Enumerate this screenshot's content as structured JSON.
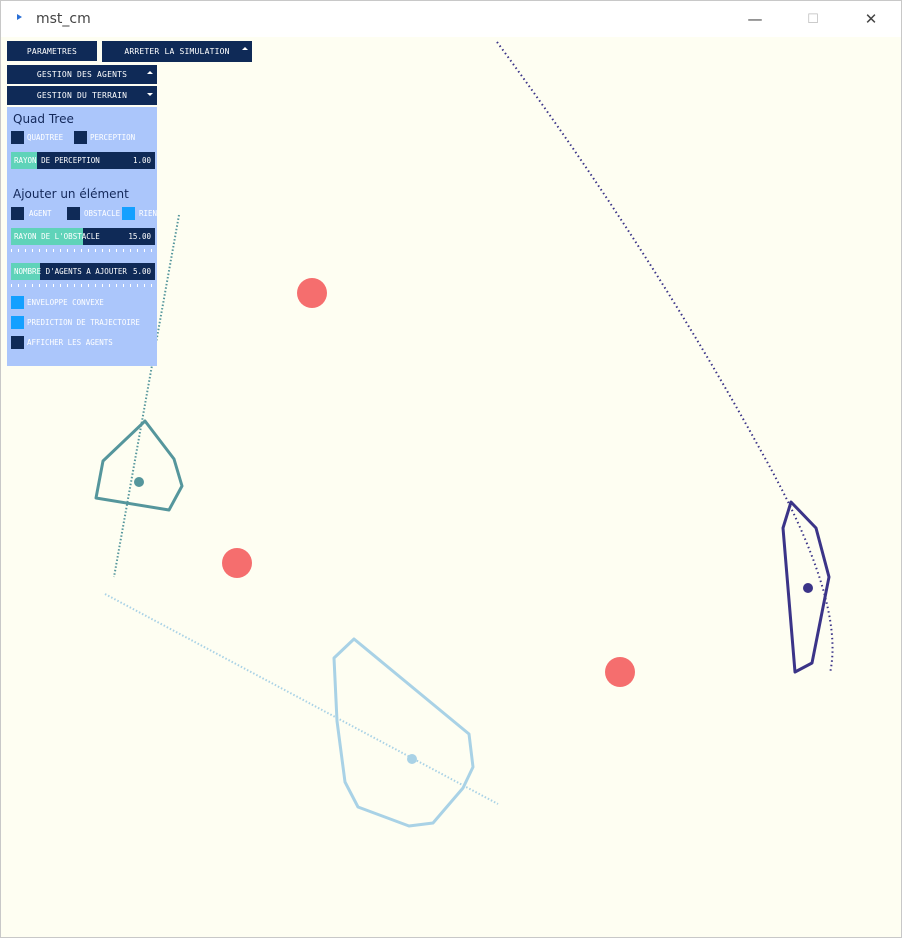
{
  "window": {
    "title": "mst_cm",
    "minimize_glyph": "—",
    "maximize_glyph": "☐",
    "close_glyph": "✕"
  },
  "toolbar": {
    "parametres_label": "PARAMETRES",
    "stop_label": "ARRETER LA SIMULATION",
    "agents_label": "GESTION DES AGENTS",
    "terrain_label": "GESTION DU TERRAIN"
  },
  "panel": {
    "quadtree": {
      "heading": "Quad Tree",
      "quadtree_label": "QUADTREE",
      "quadtree_checked": false,
      "perception_label": "PERCEPTION",
      "perception_checked": false,
      "radius_label": "RAYON DE PERCEPTION",
      "radius_value": "1.00",
      "radius_level": 0.18
    },
    "add": {
      "heading": "Ajouter un élément",
      "agent_label": "AGENT",
      "agent_checked": false,
      "obstacle_label": "OBSTACLE",
      "obstacle_checked": false,
      "rien_label": "RIEN",
      "rien_checked": true,
      "obstacle_radius_label": "RAYON DE L'OBSTACLE",
      "obstacle_radius_value": "15.00",
      "obstacle_radius_level": 0.5,
      "agents_count_label": "NOMBRE D'AGENTS A AJOUTER",
      "agents_count_value": "5.00",
      "agents_count_level": 0.2
    },
    "options": {
      "convex_label": "ENVELOPPE CONVEXE",
      "convex_checked": true,
      "prediction_label": "PREDICTION DE TRAJECTOIRE",
      "prediction_checked": true,
      "show_agents_label": "AFFICHER LES AGENTS",
      "show_agents_checked": false
    }
  },
  "colors": {
    "background": "#fefef2",
    "obstacle": "#f56e6e",
    "agent_teal": "#55969c",
    "agent_lightblue": "#a9d2e6",
    "agent_purple": "#3b3488",
    "ui_dark": "#0f2a57",
    "ui_panel": "#abc6fb",
    "ui_checked": "#14a0ff",
    "ui_slider_fill": "#5fd3b9"
  }
}
